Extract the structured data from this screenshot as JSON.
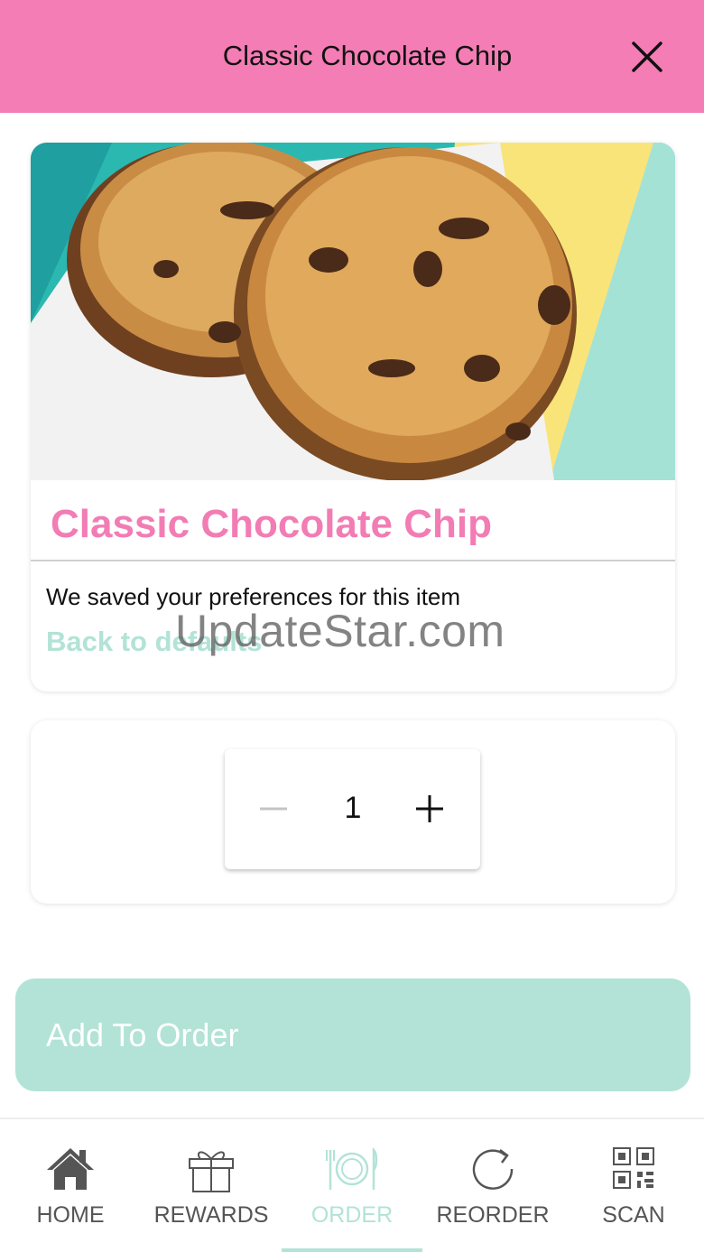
{
  "header": {
    "title": "Classic Chocolate Chip"
  },
  "product": {
    "name": "Classic Chocolate Chip",
    "saved_message": "We saved your preferences for this item",
    "back_to_defaults": "Back to defaults"
  },
  "quantity": {
    "value": "1"
  },
  "add_button": {
    "label": "Add To Order"
  },
  "watermark": "UpdateStar.com",
  "nav": {
    "items": [
      {
        "label": "HOME",
        "icon": "home-icon"
      },
      {
        "label": "REWARDS",
        "icon": "gift-icon"
      },
      {
        "label": "ORDER",
        "icon": "plate-cutlery-icon",
        "active": true
      },
      {
        "label": "REORDER",
        "icon": "refresh-icon"
      },
      {
        "label": "SCAN",
        "icon": "qr-code-icon"
      }
    ]
  },
  "colors": {
    "brand_pink": "#f47db5",
    "accent_mint": "#b2e3d6",
    "text": "#111111"
  }
}
